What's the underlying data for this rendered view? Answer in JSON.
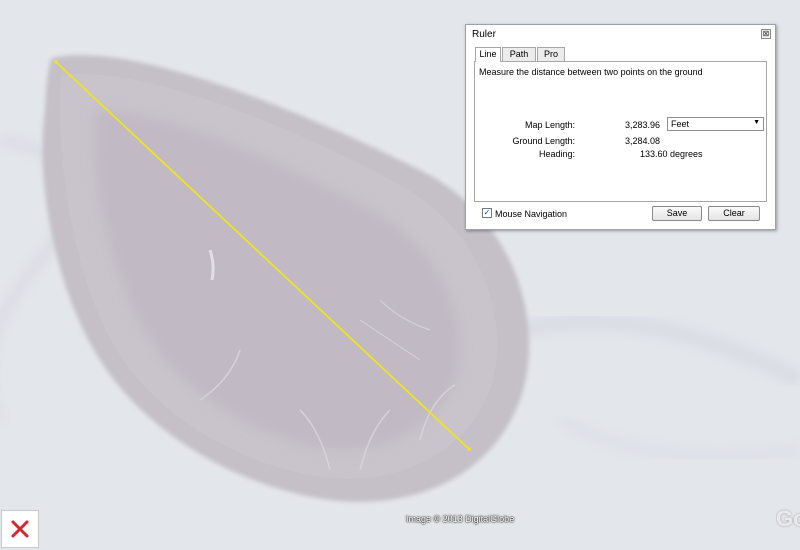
{
  "map": {
    "imagery_credit": "Image © 2013 DigitalGlobe",
    "logo_text": "Go",
    "measure_line_color": "#f2e80c"
  },
  "exit_button": {
    "icon": "close-icon",
    "color": "#d6262e"
  },
  "ruler": {
    "title": "Ruler",
    "close_glyph": "⊠",
    "tabs": [
      {
        "label": "Line",
        "active": true
      },
      {
        "label": "Path",
        "active": false
      },
      {
        "label": "Pro",
        "active": false
      }
    ],
    "description": "Measure the distance between two points on the ground",
    "map_length_label": "Map Length:",
    "map_length_value": "3,283.96",
    "unit": "Feet",
    "ground_length_label": "Ground Length:",
    "ground_length_value": "3,284.08",
    "heading_label": "Heading:",
    "heading_value": "133.60 degrees",
    "mouse_navigation_label": "Mouse Navigation",
    "mouse_navigation_checked": true,
    "check_glyph": "✓",
    "save_label": "Save",
    "clear_label": "Clear",
    "dropdown_glyph": "▼"
  }
}
